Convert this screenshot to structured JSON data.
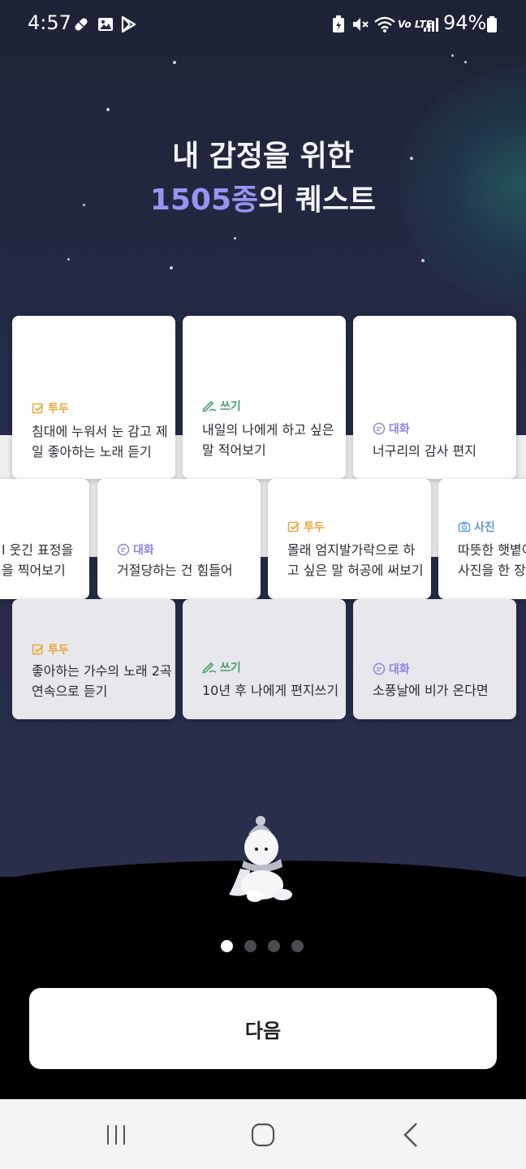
{
  "status_bar": {
    "time": "4:57",
    "network": "Vo LTE",
    "battery": "94%"
  },
  "headline": {
    "line1": "내 감정을 위한",
    "count": "1505종",
    "line2_rest": "의 퀘스트"
  },
  "quests": {
    "row1": [
      {
        "tag": "투두",
        "type": "todo",
        "title_line1": "침대에 누워서 눈 감고 제",
        "title_line2": "일 좋아하는 노래 듣기"
      },
      {
        "tag": "쓰기",
        "type": "write",
        "title_line1": "내일의 나에게 하고 싶은",
        "title_line2": "말 적어보기"
      },
      {
        "tag": "대화",
        "type": "talk",
        "title_line1": "너구리의 감사 편지",
        "title_line2": ""
      }
    ],
    "row2": [
      {
        "tag": "",
        "type": "none",
        "title_line1": "l 웃긴 표정을",
        "title_line2": "을 찍어보기"
      },
      {
        "tag": "대화",
        "type": "talk",
        "title_line1": "거절당하는 건 힘들어",
        "title_line2": ""
      },
      {
        "tag": "투두",
        "type": "todo",
        "title_line1": "몰래 엄지발가락으로 하",
        "title_line2": "고 싶은 말 허공에 써보기"
      },
      {
        "tag": "사진",
        "type": "photo",
        "title_line1": "따뜻한 햇볕이",
        "title_line2": "사진을 한 장 찍"
      }
    ],
    "row3": [
      {
        "tag": "투두",
        "type": "todo",
        "title_line1": "좋아하는 가수의 노래 2곡",
        "title_line2": "연속으로 듣기"
      },
      {
        "tag": "쓰기",
        "type": "write",
        "title_line1": "10년 후 나에게 편지쓰기",
        "title_line2": ""
      },
      {
        "tag": "대화",
        "type": "talk",
        "title_line1": "소풍날에 비가 온다면",
        "title_line2": ""
      }
    ]
  },
  "pager": {
    "total": 4,
    "current": 1
  },
  "next_button": {
    "label": "다음"
  },
  "colors": {
    "accent": "#9a93f2",
    "todo": "#e8a93a",
    "write": "#4a9e6b",
    "talk": "#8c86d9",
    "photo": "#5c9ad8"
  }
}
